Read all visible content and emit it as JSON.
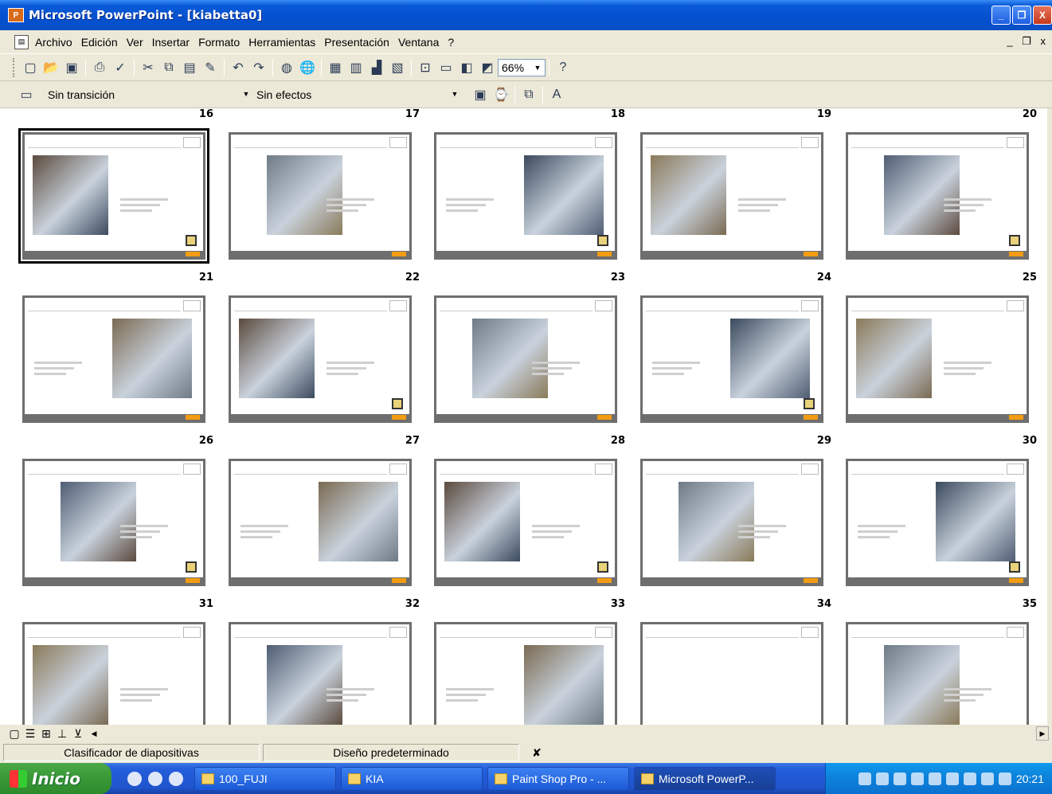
{
  "window": {
    "title": "Microsoft PowerPoint - [kiabetta0]",
    "controls": [
      "_",
      "❐",
      "X"
    ]
  },
  "menu": {
    "items": [
      "Archivo",
      "Edición",
      "Ver",
      "Insertar",
      "Formato",
      "Herramientas",
      "Presentación",
      "Ventana",
      "?"
    ],
    "mdi_controls": "_ ❐ x"
  },
  "toolbar": {
    "zoom": "66%",
    "transition": "Sin transición",
    "effects": "Sin efectos"
  },
  "slides": [
    {
      "number": "16",
      "selected": true
    },
    {
      "number": "17"
    },
    {
      "number": "18"
    },
    {
      "number": "19"
    },
    {
      "number": "20"
    },
    {
      "number": "21"
    },
    {
      "number": "22"
    },
    {
      "number": "23"
    },
    {
      "number": "24"
    },
    {
      "number": "25"
    },
    {
      "number": "26"
    },
    {
      "number": "27"
    },
    {
      "number": "28"
    },
    {
      "number": "29"
    },
    {
      "number": "30"
    },
    {
      "number": "31"
    },
    {
      "number": "32"
    },
    {
      "number": "33"
    },
    {
      "number": "34"
    },
    {
      "number": "35"
    }
  ],
  "statusbar": {
    "view": "Clasificador de diapositivas",
    "design": "Diseño predeterminado"
  },
  "taskbar": {
    "start": "Inicio",
    "tasks": [
      "100_FUJI",
      "KIA",
      "Paint Shop Pro - ...",
      "Microsoft PowerP..."
    ],
    "clock": "20:21"
  },
  "colors": {
    "title_bar": "#0550d0",
    "slide_accent": "#f39c12",
    "taskbar": "#245edb",
    "start_button": "#3b9b38"
  }
}
